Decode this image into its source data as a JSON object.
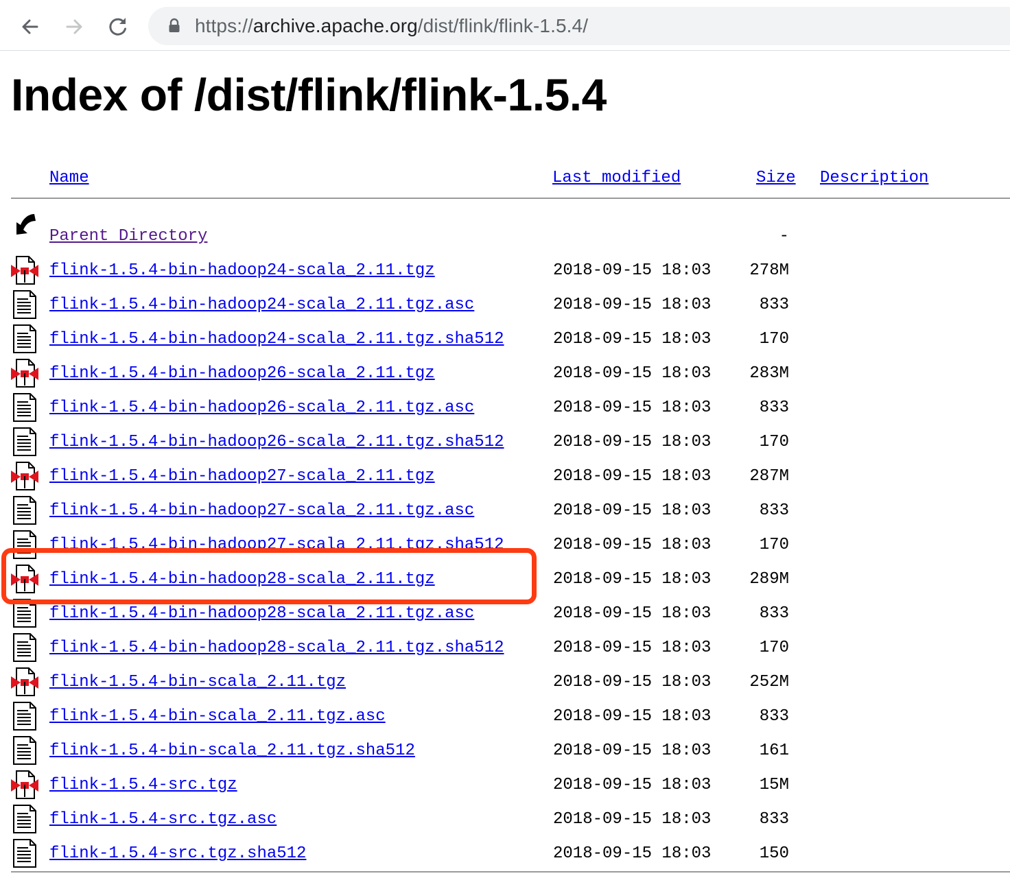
{
  "browser": {
    "url_scheme": "https://",
    "url_host": "archive.apache.org",
    "url_path": "/dist/flink/flink-1.5.4/"
  },
  "page": {
    "title": "Index of /dist/flink/flink-1.5.4",
    "columns": {
      "name": "Name",
      "last_modified": "Last modified",
      "size": "Size",
      "description": "Description"
    },
    "parent": {
      "name": "Parent Directory",
      "size": "-"
    },
    "files": [
      {
        "name": "flink-1.5.4-bin-hadoop24-scala_2.11.tgz",
        "date": "2018-09-15 18:03",
        "size": "278M",
        "icon": "archive-icon"
      },
      {
        "name": "flink-1.5.4-bin-hadoop24-scala_2.11.tgz.asc",
        "date": "2018-09-15 18:03",
        "size": "833",
        "icon": "text-file-icon"
      },
      {
        "name": "flink-1.5.4-bin-hadoop24-scala_2.11.tgz.sha512",
        "date": "2018-09-15 18:03",
        "size": "170",
        "icon": "text-file-icon"
      },
      {
        "name": "flink-1.5.4-bin-hadoop26-scala_2.11.tgz",
        "date": "2018-09-15 18:03",
        "size": "283M",
        "icon": "archive-icon"
      },
      {
        "name": "flink-1.5.4-bin-hadoop26-scala_2.11.tgz.asc",
        "date": "2018-09-15 18:03",
        "size": "833",
        "icon": "text-file-icon"
      },
      {
        "name": "flink-1.5.4-bin-hadoop26-scala_2.11.tgz.sha512",
        "date": "2018-09-15 18:03",
        "size": "170",
        "icon": "text-file-icon"
      },
      {
        "name": "flink-1.5.4-bin-hadoop27-scala_2.11.tgz",
        "date": "2018-09-15 18:03",
        "size": "287M",
        "icon": "archive-icon"
      },
      {
        "name": "flink-1.5.4-bin-hadoop27-scala_2.11.tgz.asc",
        "date": "2018-09-15 18:03",
        "size": "833",
        "icon": "text-file-icon"
      },
      {
        "name": "flink-1.5.4-bin-hadoop27-scala_2.11.tgz.sha512",
        "date": "2018-09-15 18:03",
        "size": "170",
        "icon": "text-file-icon"
      },
      {
        "name": "flink-1.5.4-bin-hadoop28-scala_2.11.tgz",
        "date": "2018-09-15 18:03",
        "size": "289M",
        "icon": "archive-icon"
      },
      {
        "name": "flink-1.5.4-bin-hadoop28-scala_2.11.tgz.asc",
        "date": "2018-09-15 18:03",
        "size": "833",
        "icon": "text-file-icon"
      },
      {
        "name": "flink-1.5.4-bin-hadoop28-scala_2.11.tgz.sha512",
        "date": "2018-09-15 18:03",
        "size": "170",
        "icon": "text-file-icon"
      },
      {
        "name": "flink-1.5.4-bin-scala_2.11.tgz",
        "date": "2018-09-15 18:03",
        "size": "252M",
        "icon": "archive-icon"
      },
      {
        "name": "flink-1.5.4-bin-scala_2.11.tgz.asc",
        "date": "2018-09-15 18:03",
        "size": "833",
        "icon": "text-file-icon"
      },
      {
        "name": "flink-1.5.4-bin-scala_2.11.tgz.sha512",
        "date": "2018-09-15 18:03",
        "size": "161",
        "icon": "text-file-icon"
      },
      {
        "name": "flink-1.5.4-src.tgz",
        "date": "2018-09-15 18:03",
        "size": "15M",
        "icon": "archive-icon"
      },
      {
        "name": "flink-1.5.4-src.tgz.asc",
        "date": "2018-09-15 18:03",
        "size": "833",
        "icon": "text-file-icon"
      },
      {
        "name": "flink-1.5.4-src.tgz.sha512",
        "date": "2018-09-15 18:03",
        "size": "150",
        "icon": "text-file-icon"
      }
    ]
  },
  "annotation": {
    "highlight_color": "#ff3b12",
    "highlighted_file": "flink-1.5.4-bin-hadoop28-scala_2.11.tgz"
  }
}
